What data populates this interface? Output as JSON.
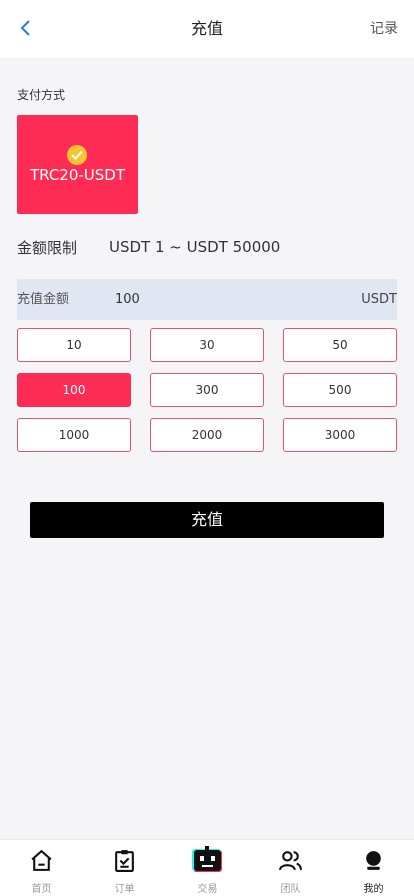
{
  "header": {
    "title": "充值",
    "right_link": "记录"
  },
  "payment": {
    "label": "支付方式",
    "method": "TRC20-USDT"
  },
  "limit": {
    "label": "金额限制",
    "value": "USDT 1 ~ USDT 50000"
  },
  "amount": {
    "label": "充值金额",
    "value": "100",
    "unit": "USDT"
  },
  "presets": [
    "10",
    "30",
    "50",
    "100",
    "300",
    "500",
    "1000",
    "2000",
    "3000"
  ],
  "selected_preset": "100",
  "submit_label": "充值",
  "tabs": [
    {
      "label": "首页",
      "icon": "home-icon"
    },
    {
      "label": "订单",
      "icon": "clipboard-icon"
    },
    {
      "label": "交易",
      "icon": "robot-icon"
    },
    {
      "label": "团队",
      "icon": "team-icon"
    },
    {
      "label": "我的",
      "icon": "profile-icon"
    }
  ],
  "active_tab": "我的",
  "colors": {
    "accent": "#fe2c55",
    "check": "#f5c531",
    "amount_bg": "#e1e6f3",
    "back_arrow": "#2a7ae2"
  }
}
